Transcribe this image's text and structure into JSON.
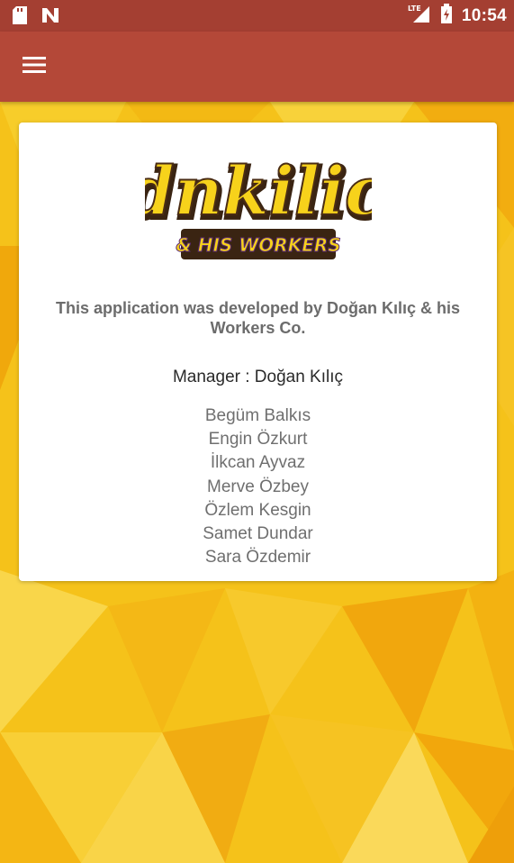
{
  "status_bar": {
    "time": "10:54",
    "network_label": "LTE",
    "icons": [
      "sd-card-icon",
      "n-notification-icon",
      "lte-signal-icon",
      "battery-icon"
    ]
  },
  "app_bar": {
    "menu_icon": "hamburger-menu-icon"
  },
  "logo": {
    "title": "dnkilic",
    "subtitle": "& HIS WORKERS"
  },
  "about": {
    "developer_text": "This application was developed by Doğan Kılıç & his Workers Co.",
    "manager_text": "Manager : Doğan Kılıç",
    "workers": [
      "Begüm Balkıs",
      "Engin Özkurt",
      "İlkcan Ayvaz",
      "Merve Özbey",
      "Özlem Kesgin",
      "Samet Dundar",
      "Sara Özdemir"
    ]
  },
  "colors": {
    "status_bar": "#a43f32",
    "app_bar": "#b44838",
    "background_yellow": "#f5c21a",
    "background_orange": "#f0a30a",
    "logo_yellow": "#f7d21b",
    "logo_purple": "#5b2a78"
  }
}
